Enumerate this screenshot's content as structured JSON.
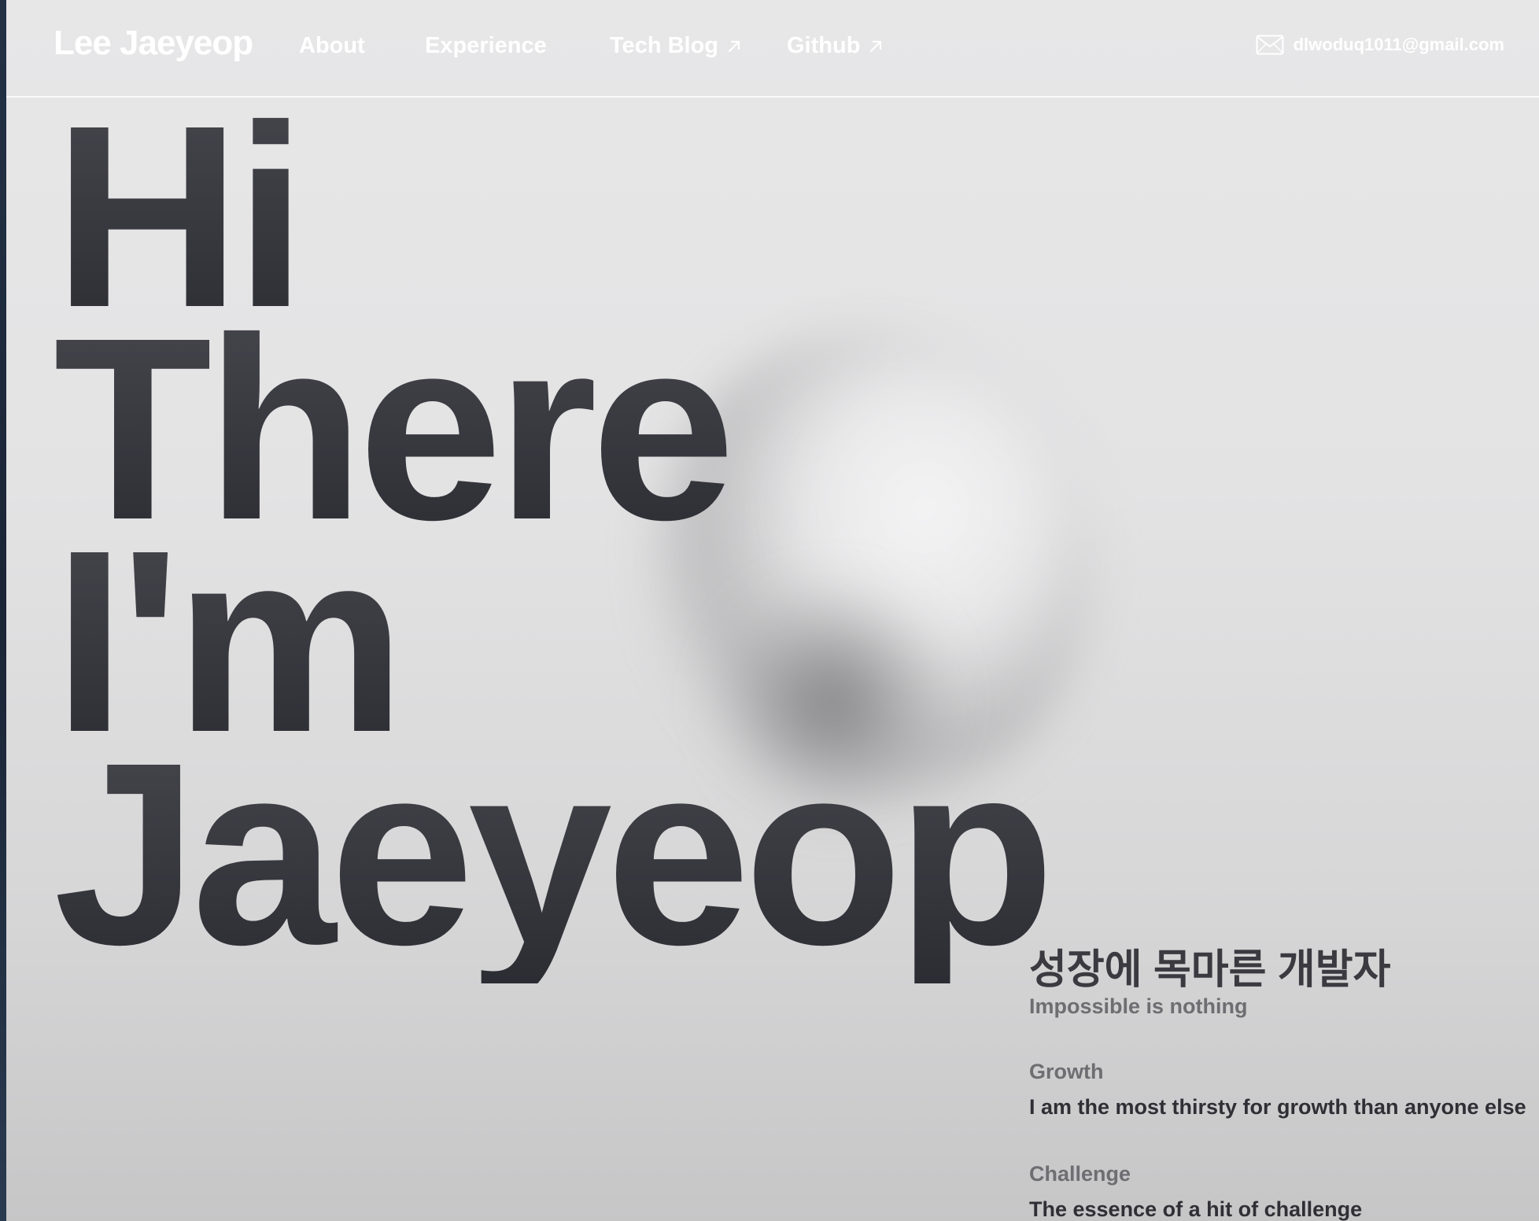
{
  "nav": {
    "brand": "Lee Jaeyeop",
    "links": [
      {
        "label": "About",
        "external": false
      },
      {
        "label": "Experience",
        "external": false
      },
      {
        "label": "Tech Blog",
        "external": true
      },
      {
        "label": "Github",
        "external": true
      }
    ],
    "email": "dlwoduq1011@gmail.com",
    "email_icon": "mail-icon",
    "external_icon": "arrow-up-right-icon"
  },
  "hero": {
    "lines": [
      "Hi",
      "There",
      "I'm",
      "Jaeyeop"
    ]
  },
  "intro": {
    "headline": "성장에 목마른 개발자",
    "tagline": "Impossible is nothing",
    "sections": [
      {
        "title": "Growth",
        "text": "I am the most thirsty for growth than anyone else"
      },
      {
        "title": "Challenge",
        "text": "The essence of a hit of challenge"
      }
    ]
  },
  "colors": {
    "background": "#e4e4e5",
    "hero_text": "#34343b",
    "nav_text": "#ffffff",
    "muted_text": "#6e6e72"
  }
}
